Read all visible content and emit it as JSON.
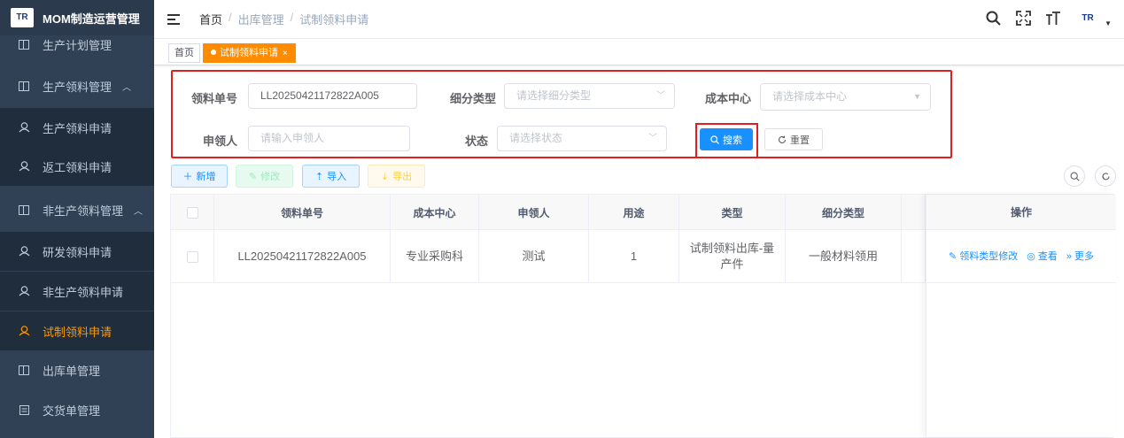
{
  "app": {
    "logo_text": "TR",
    "title": "MOM制造运营管理"
  },
  "sidebar": {
    "items": [
      {
        "label": "生产计划管理",
        "icon": "box-icon"
      },
      {
        "label": "生产领料管理",
        "icon": "box-icon",
        "arrow": "^"
      },
      {
        "label": "生产领料申请",
        "icon": "user-icon"
      },
      {
        "label": "返工领料申请",
        "icon": "user-icon"
      },
      {
        "label": "非生产领料管理",
        "icon": "box-icon",
        "arrow": "^"
      },
      {
        "label": "研发领料申请",
        "icon": "user-icon"
      },
      {
        "label": "非生产领料申请",
        "icon": "user-icon"
      },
      {
        "label": "试制领料申请",
        "icon": "user-icon",
        "active": true
      },
      {
        "label": "出库单管理",
        "icon": "box-icon"
      },
      {
        "label": "交货单管理",
        "icon": "list-icon"
      }
    ]
  },
  "header": {
    "breadcrumb": {
      "home": "首页",
      "sep": "/",
      "level1": "出库管理",
      "level2": "试制领料申请"
    },
    "avatar_text": "TR"
  },
  "tags": {
    "home": "首页",
    "current": "试制领料申请",
    "close": "×"
  },
  "search": {
    "order_no": {
      "label": "领料单号",
      "value": "LL20250421172822A005"
    },
    "subtype": {
      "label": "细分类型",
      "placeholder": "请选择细分类型"
    },
    "cost_center": {
      "label": "成本中心",
      "placeholder": "请选择成本中心"
    },
    "applicant": {
      "label": "申领人",
      "placeholder": "请输入申领人"
    },
    "status": {
      "label": "状态",
      "placeholder": "请选择状态"
    },
    "search_button": "搜索",
    "reset_button": "重置"
  },
  "toolbar": {
    "add": "新增",
    "edit": "修改",
    "import": "导入",
    "export": "导出"
  },
  "table": {
    "columns": [
      "领料单号",
      "成本中心",
      "申领人",
      "用途",
      "类型",
      "细分类型",
      "操作"
    ],
    "rows": [
      {
        "order_no": "LL20250421172822A005",
        "cost_center": "专业采购科",
        "applicant": "测试",
        "purpose": "1",
        "type": "试制领料出库-量产件",
        "subtype": "一般材料领用"
      }
    ],
    "actions": {
      "edit_type": "领料类型修改",
      "view": "查看",
      "more": "更多"
    }
  },
  "colors": {
    "sidebar_bg": "#304156",
    "accent": "#ff9900",
    "primary": "#1890ff",
    "highlight": "#e02020"
  }
}
